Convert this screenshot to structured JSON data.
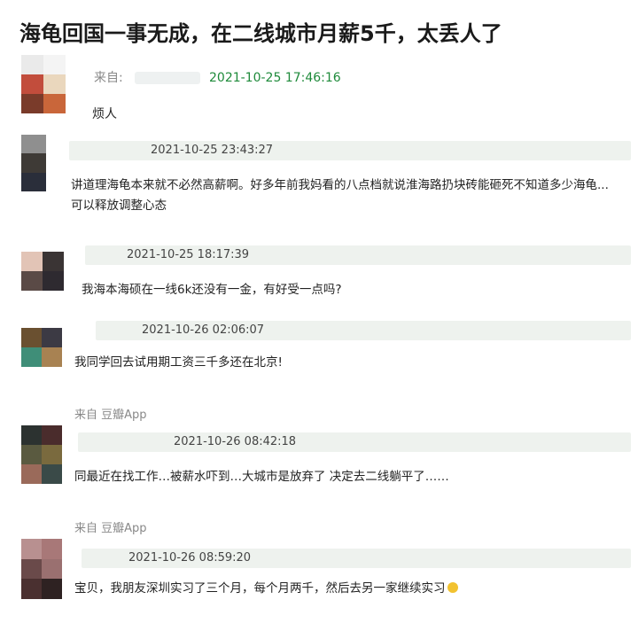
{
  "headline": "海龟回国一事无成，在二线城市月薪5千，太丢人了",
  "colors": {
    "timestamp_green": "#1e8a3a",
    "strip_bg": "#eef2ee"
  },
  "comments": [
    {
      "source": "来自:",
      "timestamp": "2021-10-25 17:46:16",
      "text": "烦人"
    },
    {
      "timestamp": "2021-10-25 23:43:27",
      "text": "讲道理海龟本来就不必然高薪啊。好多年前我妈看的八点档就说淮海路扔块砖能砸死不知道多少海龟... 可以释放调整心态"
    },
    {
      "timestamp": "2021-10-25 18:17:39",
      "text": "我海本海硕在一线6k还没有一金，有好受一点吗?"
    },
    {
      "timestamp": "2021-10-26 02:06:07",
      "text": "我同学回去试用期工资三千多还在北京!"
    },
    {
      "source": "来自 豆瓣App",
      "timestamp": "2021-10-26 08:42:18",
      "text": "同最近在找工作…被薪水吓到…大城市是放弃了 决定去二线躺平了……"
    },
    {
      "source": "来自 豆瓣App",
      "timestamp": "2021-10-26 08:59:20",
      "text": "宝贝，我朋友深圳实习了三个月，每个月两千，然后去另一家继续实习",
      "emoji": "smiling-face-emoji"
    }
  ]
}
